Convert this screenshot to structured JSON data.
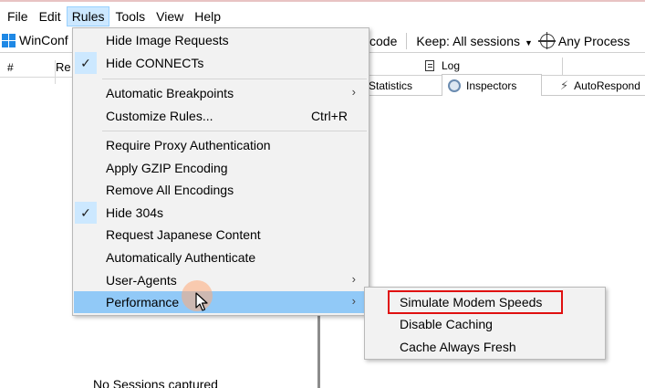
{
  "menubar": [
    "File",
    "Edit",
    "Rules",
    "Tools",
    "View",
    "Help"
  ],
  "toolbar": {
    "winconfig": "WinConf",
    "decode": "code",
    "keep": "Keep: All sessions",
    "process": "Any Process"
  },
  "sessions": {
    "col_hash": "#",
    "col_result": "Re",
    "empty": "No Sessions captured"
  },
  "tabs": {
    "log": "Log",
    "statistics": "Statistics",
    "inspectors": "Inspectors",
    "autoresponder": "AutoRespond"
  },
  "rules_menu": {
    "hide_image_requests": "Hide Image Requests",
    "hide_connects": "Hide CONNECTs",
    "automatic_breakpoints": "Automatic Breakpoints",
    "customize_rules": "Customize Rules...",
    "customize_shortcut": "Ctrl+R",
    "require_proxy_auth": "Require Proxy Authentication",
    "apply_gzip": "Apply GZIP Encoding",
    "remove_encodings": "Remove All Encodings",
    "hide_304s": "Hide 304s",
    "request_japanese": "Request Japanese Content",
    "auto_authenticate": "Automatically Authenticate",
    "user_agents": "User-Agents",
    "performance": "Performance",
    "check_glyph": "✓",
    "arrow_glyph": "›"
  },
  "performance_submenu": {
    "simulate_modem": "Simulate Modem Speeds",
    "disable_caching": "Disable Caching",
    "cache_always_fresh": "Cache Always Fresh"
  },
  "colors": {
    "highlight": "#91c9f7",
    "check_bg": "#cce8ff",
    "annotation_red": "#e01010"
  }
}
